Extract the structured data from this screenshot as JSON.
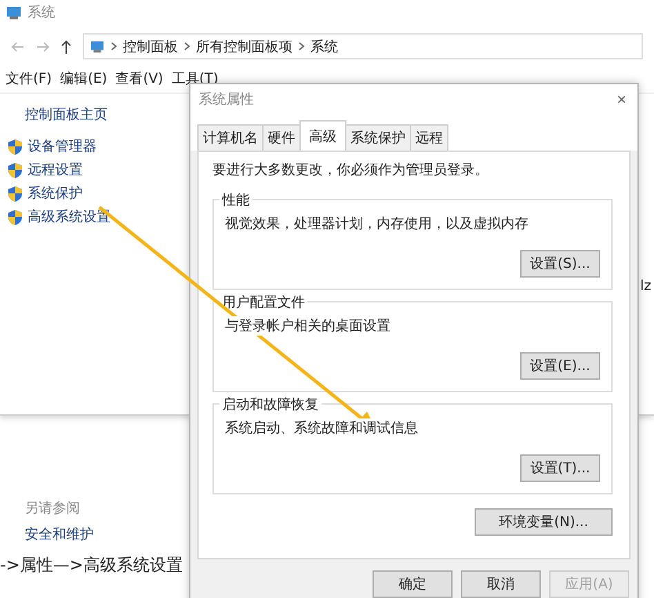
{
  "window": {
    "title": "系统"
  },
  "address_bar": {
    "path": [
      "控制面板",
      "所有控制面板项",
      "系统"
    ]
  },
  "menu": [
    "文件(F)",
    "编辑(E)",
    "查看(V)",
    "工具(T)"
  ],
  "sidebar": {
    "home": "控制面板主页",
    "links": [
      "设备管理器",
      "远程设置",
      "系统保护",
      "高级系统设置"
    ],
    "see_also": "另请参阅",
    "see_also_links": [
      "安全和维护"
    ]
  },
  "background_text": "lz",
  "caption": "->属性—>高级系统设置",
  "dialog": {
    "title": "系统属性",
    "close": "×",
    "tabs": [
      {
        "label": "计算机名",
        "selected": false
      },
      {
        "label": "硬件",
        "selected": false
      },
      {
        "label": "高级",
        "selected": true
      },
      {
        "label": "系统保护",
        "selected": false
      },
      {
        "label": "远程",
        "selected": false
      }
    ],
    "notice": "要进行大多数更改，你必须作为管理员登录。",
    "groups": [
      {
        "title": "性能",
        "text": "视觉效果，处理器计划，内存使用，以及虚拟内存",
        "button": "设置(S)..."
      },
      {
        "title": "用户配置文件",
        "text": "与登录帐户相关的桌面设置",
        "button": "设置(E)..."
      },
      {
        "title": "启动和故障恢复",
        "text": "系统启动、系统故障和调试信息",
        "button": "设置(T)..."
      }
    ],
    "env_button": "环境变量(N)...",
    "buttons": [
      {
        "label": "确定",
        "disabled": false
      },
      {
        "label": "取消",
        "disabled": false
      },
      {
        "label": "应用(A)",
        "disabled": true
      }
    ]
  }
}
